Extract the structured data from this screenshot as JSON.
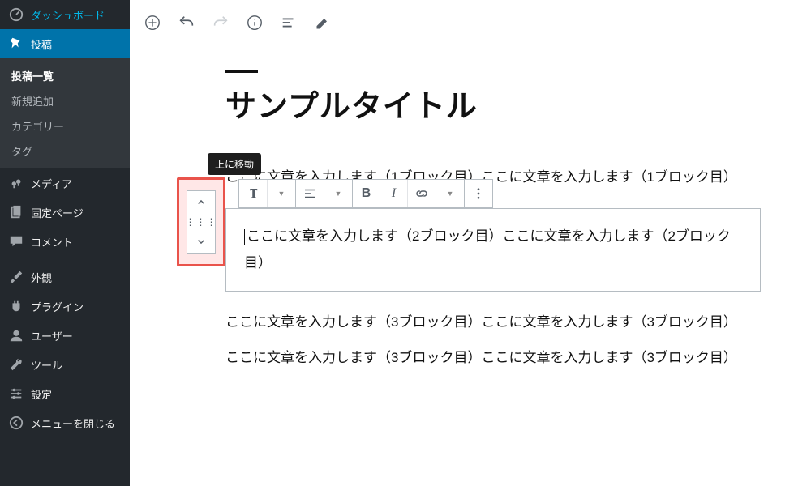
{
  "sidebar": {
    "dashboard": "ダッシュボード",
    "posts": "投稿",
    "posts_sub": {
      "list": "投稿一覧",
      "new": "新規追加",
      "cat": "カテゴリー",
      "tag": "タグ"
    },
    "media": "メディア",
    "pages": "固定ページ",
    "comments": "コメント",
    "appearance": "外観",
    "plugins": "プラグイン",
    "users": "ユーザー",
    "tools": "ツール",
    "settings": "設定",
    "collapse": "メニューを閉じる"
  },
  "editor": {
    "title": "サンプルタイトル",
    "para1": "ここに文章を入力します（1ブロック目）ここに文章を入力します（1ブロック目）",
    "para2": "ここに文章を入力します（2ブロック目）ここに文章を入力します（2ブロック目）",
    "para3a": "ここに文章を入力します（3ブロック目）ここに文章を入力します（3ブロック目）",
    "para3b": "ここに文章を入力します（3ブロック目）ここに文章を入力します（3ブロック目）"
  },
  "tooltip": {
    "move_up": "上に移動"
  }
}
